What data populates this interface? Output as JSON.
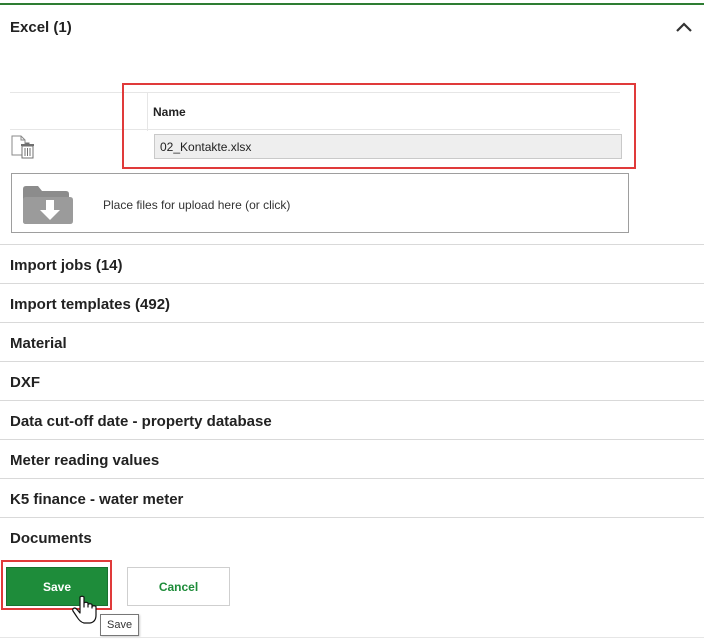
{
  "excel": {
    "title": "Excel (1)"
  },
  "table": {
    "name_header": "Name",
    "file_name": "02_Kontakte.xlsx"
  },
  "upload": {
    "text": "Place files for upload here (or click)"
  },
  "sections": [
    "Import jobs (14)",
    "Import templates (492)",
    "Material",
    "DXF",
    "Data cut-off date - property database",
    "Meter reading values",
    "K5 finance - water meter",
    "Documents"
  ],
  "buttons": {
    "save": "Save",
    "cancel": "Cancel"
  },
  "tooltip": {
    "text": "Save"
  },
  "colors": {
    "accent": "#1e8c3a",
    "highlight": "#e03a3a"
  },
  "icons": {
    "collapse": "chevron-up-icon",
    "delete": "file-delete-icon",
    "upload": "folder-download-icon",
    "pointer": "hand-cursor-icon"
  }
}
